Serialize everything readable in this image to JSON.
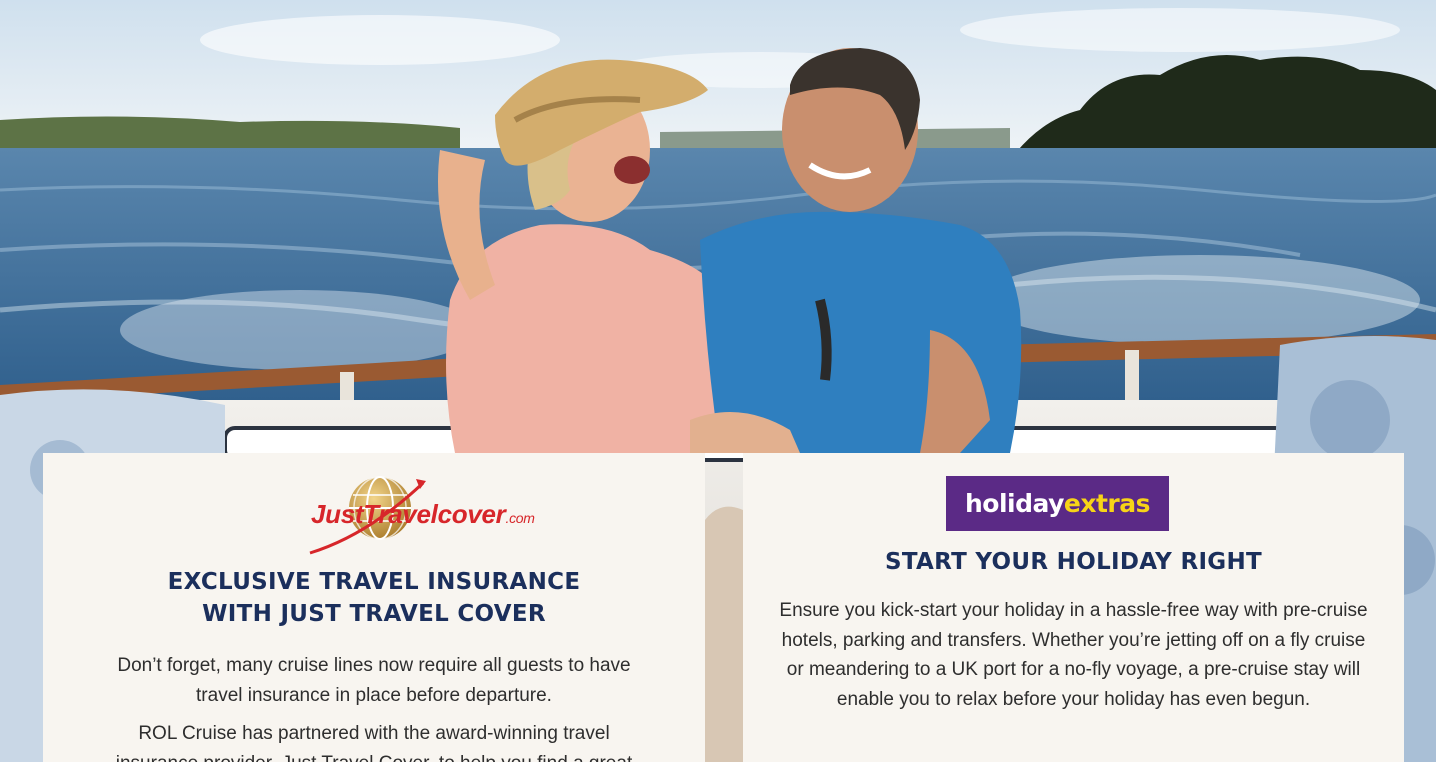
{
  "left_card": {
    "logo": {
      "brand": "JustTravelcover",
      "domain": ".com"
    },
    "title_line1": "EXCLUSIVE TRAVEL INSURANCE",
    "title_line2": "WITH JUST TRAVEL COVER",
    "para1": "Don’t forget, many cruise lines now require all guests to have travel insurance in place before departure.",
    "para2": "ROL Cruise has partnered with the award-winning travel insurance provider, Just Travel Cover, to help you find a great"
  },
  "right_card": {
    "logo": {
      "holiday": "holiday",
      "extras": "extras"
    },
    "title": "START YOUR HOLIDAY RIGHT",
    "para": "Ensure you kick-start your holiday in a hassle-free way with pre-cruise hotels, parking and transfers. Whether you’re jetting off on a fly cruise or meandering to a UK port for a no-fly voyage, a pre-cruise stay will enable you to relax before your holiday has even begun."
  },
  "colors": {
    "heading": "#1b2f5c",
    "holiday_extras_purple": "#5b2a86",
    "holiday_extras_yellow": "#f7d417",
    "just_travel_red": "#d7262a",
    "card_background": "#f8f5f0"
  }
}
